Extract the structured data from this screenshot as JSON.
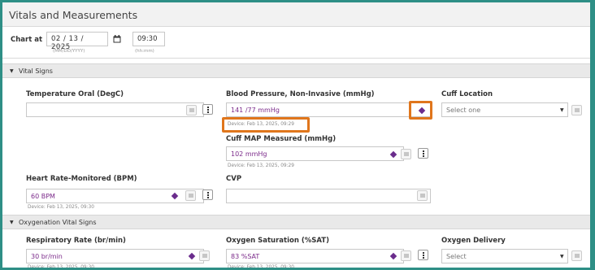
{
  "window": {
    "title": "Vitals and Measurements"
  },
  "chart_at": {
    "label": "Chart at",
    "date_value": "02 / 13 / 2025",
    "date_hint": "(MM/DD/YYYY)",
    "time_value": "09:30",
    "time_hint": "(hh:mm)"
  },
  "sections": {
    "vital_signs": {
      "title": "Vital Signs"
    },
    "oxygenation": {
      "title": "Oxygenation Vital Signs"
    }
  },
  "fields": {
    "temperature": {
      "label": "Temperature Oral (DegC)",
      "value": ""
    },
    "blood_pressure": {
      "label": "Blood Pressure, Non-Invasive (mmHg)",
      "value": "141 /77   mmHg",
      "device": "Device: Feb 13, 2025, 09:29"
    },
    "cuff_location": {
      "label": "Cuff Location",
      "placeholder": "Select one"
    },
    "cuff_map": {
      "label": "Cuff MAP Measured (mmHg)",
      "value": "102 mmHg",
      "device": "Device: Feb 13, 2025, 09:29"
    },
    "heart_rate": {
      "label": "Heart Rate-Monitored (BPM)",
      "value": "60 BPM",
      "device": "Device: Feb 13, 2025, 09:30"
    },
    "cvp": {
      "label": "CVP",
      "value": ""
    },
    "respiratory_rate": {
      "label": "Respiratory Rate (br/min)",
      "value": "30 br/min",
      "device": "Device: Feb 13, 2025, 09:30"
    },
    "oxygen_saturation": {
      "label": "Oxygen Saturation (%SAT)",
      "value": "83 %SAT",
      "device": "Device: Feb 13, 2025, 09:30"
    },
    "oxygen_delivery": {
      "label": "Oxygen Delivery",
      "placeholder": "Select"
    }
  },
  "colors": {
    "frame_border": "#2e8f86",
    "highlight": "#e0761c",
    "device_value": "#7b2a8a",
    "diamond": "#6a2c8c"
  }
}
